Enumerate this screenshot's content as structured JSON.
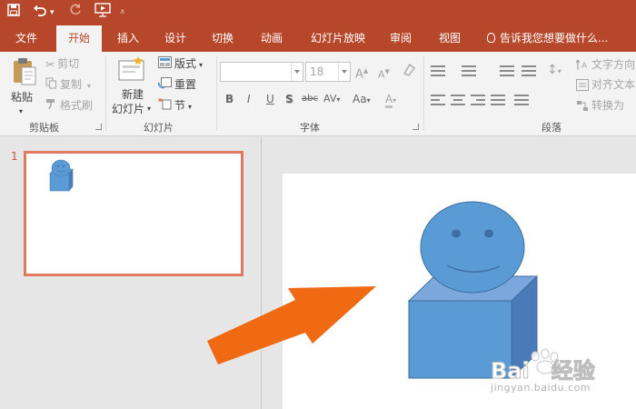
{
  "quick_access": {
    "save_icon": "save-icon",
    "undo_icon": "undo-icon",
    "redo_icon": "redo-icon",
    "present_icon": "start-from-beginning-icon",
    "customize_icon": "customize-toolbar-icon"
  },
  "tabs": [
    {
      "label": "文件"
    },
    {
      "label": "开始",
      "active": true
    },
    {
      "label": "插入"
    },
    {
      "label": "设计"
    },
    {
      "label": "切换"
    },
    {
      "label": "动画"
    },
    {
      "label": "幻灯片放映"
    },
    {
      "label": "审阅"
    },
    {
      "label": "视图"
    }
  ],
  "tell_me": "告诉我您想要做什么...",
  "clipboard": {
    "paste": "粘贴",
    "cut": "剪切",
    "copy": "复制",
    "format_painter": "格式刷",
    "group": "剪贴板"
  },
  "slides": {
    "new_slide_line1": "新建",
    "new_slide_line2": "幻灯片",
    "layout": "版式",
    "reset": "重置",
    "section": "节",
    "group": "幻灯片"
  },
  "font": {
    "font_name": "",
    "font_size": "18",
    "bold": "B",
    "italic": "I",
    "underline": "U",
    "shadow": "S",
    "strikethrough": "abc",
    "spacing": "AV",
    "change_case": "Aa",
    "group": "字体"
  },
  "paragraph": {
    "text_direction": "文字方向",
    "align_text": "对齐文本",
    "convert": "转换为",
    "group": "段落"
  },
  "thumbnail": {
    "slide_number": "1"
  },
  "watermark": {
    "brand": "Bai",
    "brand_suffix": "经验",
    "url": "jingyan.baidu.com"
  },
  "colors": {
    "accent": "#b7472a",
    "shape_fill": "#5b9bd5",
    "arrow": "#f06a14",
    "thumb_border": "#e07a5f"
  }
}
